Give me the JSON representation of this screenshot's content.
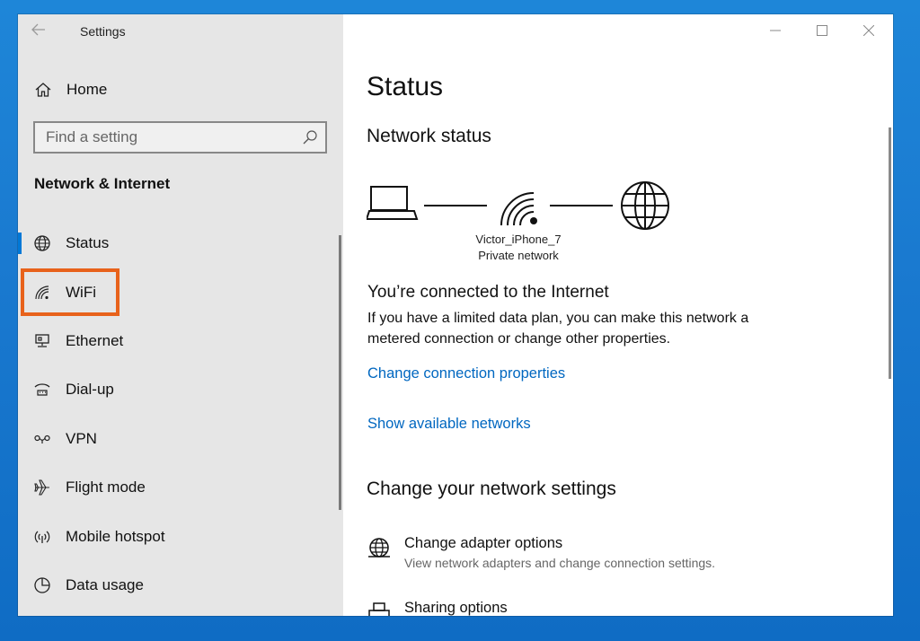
{
  "titlebar": {
    "title": "Settings"
  },
  "sidebar": {
    "home_label": "Home",
    "search_placeholder": "Find a setting",
    "section_title": "Network & Internet",
    "items": [
      {
        "label": "Status",
        "icon": "globe-icon"
      },
      {
        "label": "WiFi",
        "icon": "wifi-icon"
      },
      {
        "label": "Ethernet",
        "icon": "ethernet-icon"
      },
      {
        "label": "Dial-up",
        "icon": "dialup-icon"
      },
      {
        "label": "VPN",
        "icon": "vpn-icon"
      },
      {
        "label": "Flight mode",
        "icon": "airplane-icon"
      },
      {
        "label": "Mobile hotspot",
        "icon": "hotspot-icon"
      },
      {
        "label": "Data usage",
        "icon": "data-usage-icon"
      }
    ],
    "active_item": "Status",
    "highlighted_item": "WiFi"
  },
  "main": {
    "page_title": "Status",
    "network_status_heading": "Network status",
    "network_name": "Victor_iPhone_7",
    "network_type": "Private network",
    "connected_title": "You’re connected to the Internet",
    "connected_desc": "If you have a limited data plan, you can make this network a metered connection or change other properties.",
    "link_change_props": "Change connection properties",
    "link_show_networks": "Show available networks",
    "change_settings_heading": "Change your network settings",
    "options": [
      {
        "title": "Change adapter options",
        "subtitle": "View network adapters and change connection settings.",
        "icon": "adapter-globe-icon"
      },
      {
        "title": "Sharing options",
        "subtitle": "",
        "icon": "printer-icon"
      }
    ]
  },
  "colors": {
    "accent": "#0078d7",
    "link": "#0067c0",
    "highlight": "#e8621b",
    "sidebar_bg": "#e6e6e6",
    "desktop": "#1a7ad0"
  }
}
